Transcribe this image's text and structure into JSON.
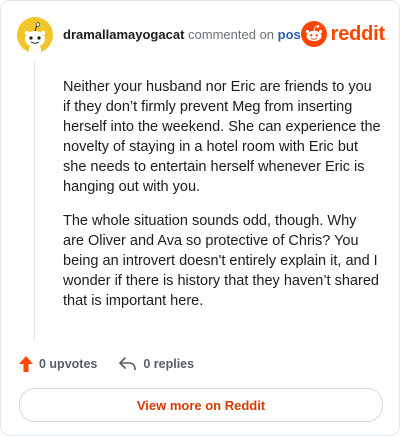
{
  "header": {
    "username": "dramallamayogacat",
    "action_text": "commented on",
    "post_link": "post",
    "brand_wordmark": "reddit"
  },
  "comment": {
    "paragraphs": [
      "Neither your husband nor Eric are friends to you if they don’t firmly prevent Meg from inserting herself into the weekend. She can experience the novelty of staying in a hotel room with Eric but she needs to entertain herself whenever Eric is hanging out with you.",
      "The whole situation sounds odd, though. Why are Oliver and Ava so protective of Chris? You being an introvert doesn't entirely explain it, and I wonder if there is history that they haven’t shared that is important here."
    ]
  },
  "actions": {
    "upvotes_label": "0 upvotes",
    "replies_label": "0 replies"
  },
  "cta": {
    "label": "View more on Reddit"
  },
  "colors": {
    "brand": "#ff4500",
    "avatar": "#f2c62b",
    "link": "#2a5db0"
  },
  "icons": [
    "snoo-avatar-icon",
    "reddit-logo-icon",
    "upvote-arrow-icon",
    "reply-arrow-icon"
  ]
}
